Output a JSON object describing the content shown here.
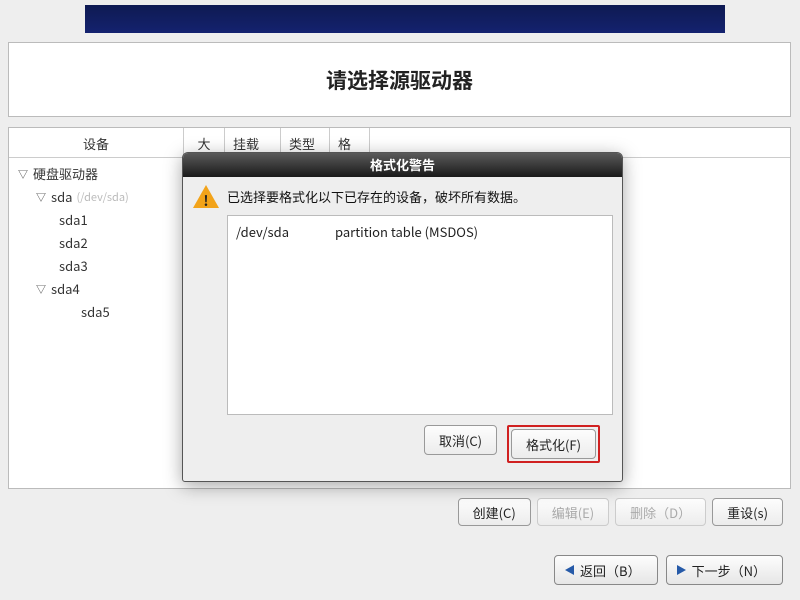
{
  "title": "请选择源驱动器",
  "columns": {
    "device": "设备",
    "size": "大小",
    "mount": "挂载点/",
    "type": "类型",
    "format": "格式"
  },
  "tree": {
    "root_label": "硬盘驱动器",
    "sda_label": "sda",
    "sda_path": "(/dev/sda)",
    "children": [
      "sda1",
      "sda2",
      "sda3",
      "sda4",
      "sda5"
    ]
  },
  "dialog": {
    "title": "格式化警告",
    "message": "已选择要格式化以下已存在的设备，破坏所有数据。",
    "device": "/dev/sda",
    "device_desc": "partition table (MSDOS)",
    "cancel": "取消(C)",
    "format": "格式化(F)"
  },
  "buttons": {
    "create": "创建(C)",
    "edit": "编辑(E)",
    "delete": "删除（D）",
    "reset": "重设(s)",
    "back": "返回（B）",
    "next": "下一步（N）"
  }
}
